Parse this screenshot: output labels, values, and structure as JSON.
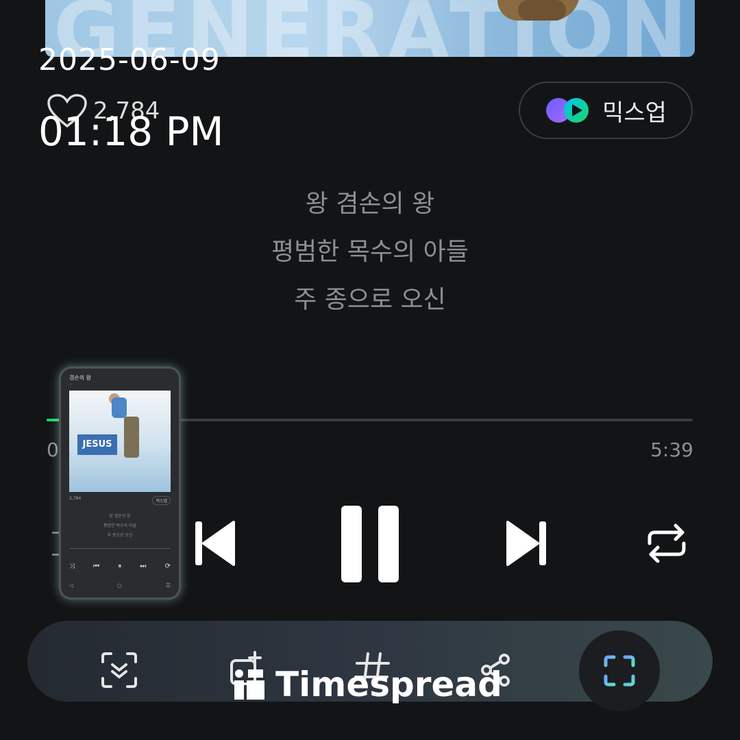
{
  "album_strip": {
    "text": "GENERATION"
  },
  "timestamp": {
    "date": "2025-06-09",
    "time": "01:18 PM"
  },
  "like": {
    "count": "2,784"
  },
  "mixup": {
    "label": "믹스업"
  },
  "lyrics": [
    "왕 겸손의 왕",
    "평범한 목수의 아들",
    "주 종으로 오신"
  ],
  "playback": {
    "current_time": "0",
    "total_time": "5:39",
    "progress": 0.02
  },
  "thumbnail": {
    "song_title": "겸손의 왕",
    "artist": "...",
    "art_text": "JESUS",
    "like_count": "2,784",
    "mixup": "믹스업",
    "lyrics": [
      "왕 겸손의 왕",
      "평범한 목수의 아들",
      "주 종으로 오신"
    ]
  },
  "watermark": {
    "text": "Timespread"
  },
  "colors": {
    "accent": "#1ed760",
    "background": "#131416"
  }
}
